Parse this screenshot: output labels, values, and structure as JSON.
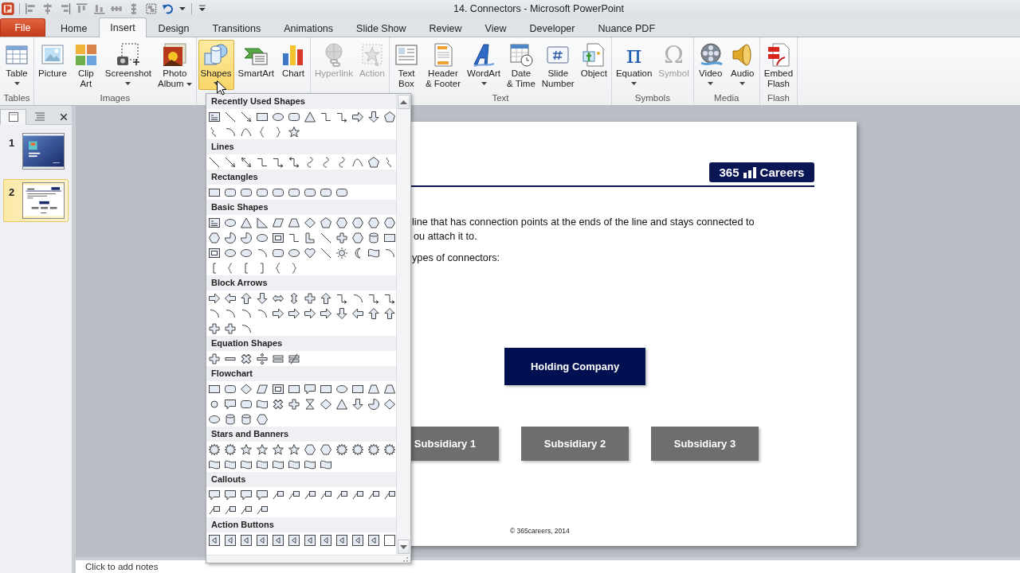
{
  "window": {
    "title": "14. Connectors - Microsoft PowerPoint"
  },
  "tabs": [
    {
      "label": "File",
      "kind": "file",
      "selected": false
    },
    {
      "label": "Home",
      "kind": "tab",
      "selected": false
    },
    {
      "label": "Insert",
      "kind": "tab",
      "selected": true
    },
    {
      "label": "Design",
      "kind": "tab",
      "selected": false
    },
    {
      "label": "Transitions",
      "kind": "tab",
      "selected": false
    },
    {
      "label": "Animations",
      "kind": "tab",
      "selected": false
    },
    {
      "label": "Slide Show",
      "kind": "tab",
      "selected": false
    },
    {
      "label": "Review",
      "kind": "tab",
      "selected": false
    },
    {
      "label": "View",
      "kind": "tab",
      "selected": false
    },
    {
      "label": "Developer",
      "kind": "tab",
      "selected": false
    },
    {
      "label": "Nuance PDF",
      "kind": "tab",
      "selected": false
    }
  ],
  "ribbon": {
    "groups": [
      {
        "label": "Tables",
        "buttons": [
          {
            "label": "Table",
            "kind": "table",
            "dropdown": true,
            "disabled": false,
            "open": false
          }
        ]
      },
      {
        "label": "Images",
        "buttons": [
          {
            "label": "Picture",
            "kind": "picture",
            "dropdown": false,
            "disabled": false,
            "open": false
          },
          {
            "label": "Clip\nArt",
            "kind": "clipart",
            "dropdown": false,
            "disabled": false,
            "open": false
          },
          {
            "label": "Screenshot",
            "kind": "screenshot",
            "dropdown": true,
            "disabled": false,
            "open": false
          },
          {
            "label": "Photo\nAlbum",
            "kind": "album",
            "dropdown": true,
            "disabled": false,
            "open": false
          }
        ]
      },
      {
        "buttons": [
          {
            "label": "Shapes",
            "kind": "shapes",
            "dropdown": true,
            "disabled": false,
            "open": true
          },
          {
            "label": "SmartArt",
            "kind": "smartart",
            "dropdown": false,
            "disabled": false,
            "open": false
          },
          {
            "label": "Chart",
            "kind": "chart",
            "dropdown": false,
            "disabled": false,
            "open": false
          }
        ]
      },
      {
        "buttons": [
          {
            "label": "Hyperlink",
            "kind": "hyperlink",
            "dropdown": false,
            "disabled": true,
            "open": false
          },
          {
            "label": "Action",
            "kind": "action",
            "dropdown": false,
            "disabled": true,
            "open": false
          }
        ]
      },
      {
        "label": "Text",
        "buttons": [
          {
            "label": "Text\nBox",
            "kind": "textbox",
            "dropdown": false,
            "disabled": false,
            "open": false
          },
          {
            "label": "Header\n& Footer",
            "kind": "header",
            "dropdown": false,
            "disabled": false,
            "open": false
          },
          {
            "label": "WordArt",
            "kind": "wordart",
            "dropdown": true,
            "disabled": false,
            "open": false
          },
          {
            "label": "Date\n& Time",
            "kind": "datetime",
            "dropdown": false,
            "disabled": false,
            "open": false
          },
          {
            "label": "Slide\nNumber",
            "kind": "slidenumber",
            "dropdown": false,
            "disabled": false,
            "open": false
          },
          {
            "label": "Object",
            "kind": "object",
            "dropdown": false,
            "disabled": false,
            "open": false
          }
        ]
      },
      {
        "label": "Symbols",
        "buttons": [
          {
            "label": "Equation",
            "kind": "glyph",
            "icon_text": "π",
            "dropdown": true,
            "disabled": false,
            "open": false
          },
          {
            "label": "Symbol",
            "kind": "glyph",
            "icon_text": "Ω",
            "dropdown": false,
            "disabled": true,
            "open": false
          }
        ]
      },
      {
        "label": "Media",
        "buttons": [
          {
            "label": "Video",
            "kind": "video",
            "dropdown": true,
            "disabled": false,
            "open": false
          },
          {
            "label": "Audio",
            "kind": "audio",
            "dropdown": true,
            "disabled": false,
            "open": false
          }
        ]
      },
      {
        "label": "Flash",
        "buttons": [
          {
            "label": "Embed\nFlash",
            "kind": "flash",
            "dropdown": false,
            "disabled": false,
            "open": false
          }
        ]
      }
    ]
  },
  "slides_pane": {
    "tabs": [
      {
        "kind": "slides",
        "selected": true
      },
      {
        "kind": "outline",
        "selected": false
      }
    ],
    "thumbnails": [
      {
        "number": "1",
        "kind": "title",
        "selected": false
      },
      {
        "number": "2",
        "kind": "content",
        "selected": true
      }
    ]
  },
  "shapes_gallery": {
    "sections": [
      {
        "title": "Recently Used Shapes"
      },
      {
        "title": "Lines"
      },
      {
        "title": "Rectangles"
      },
      {
        "title": "Basic Shapes"
      },
      {
        "title": "Block Arrows"
      },
      {
        "title": "Equation Shapes"
      },
      {
        "title": "Flowchart"
      },
      {
        "title": "Stars and Banners"
      },
      {
        "title": "Callouts"
      },
      {
        "title": "Action Buttons"
      }
    ]
  },
  "slide": {
    "logo": {
      "number": "365",
      "name": "Careers"
    },
    "body_lines": [
      "line that has connection points at the ends of the line and stays connected to",
      "ou attach it to.",
      "ypes of connectors:"
    ],
    "org_chart": {
      "label": "Holding Company",
      "children": [
        {
          "label": "Subsidiary 1"
        },
        {
          "label": "Subsidiary 2"
        },
        {
          "label": "Subsidiary 3"
        }
      ]
    },
    "footer": "© 365careers, 2014"
  },
  "notes": {
    "placeholder": "Click to add notes"
  }
}
